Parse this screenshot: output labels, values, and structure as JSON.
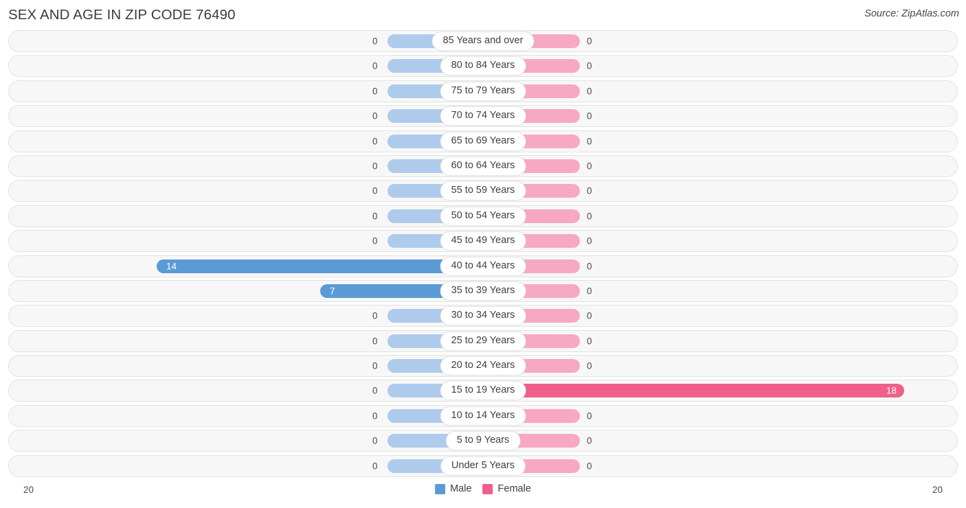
{
  "header": {
    "title": "SEX AND AGE IN ZIP CODE 76490",
    "source": "Source: ZipAtlas.com"
  },
  "legend": {
    "male_label": "Male",
    "female_label": "Female",
    "male_color": "#5b9bd5",
    "female_color": "#ef5f8a",
    "male_zero_color": "#aecbec",
    "female_zero_color": "#f7a8c2"
  },
  "axis": {
    "left_max": "20",
    "right_max": "20"
  },
  "chart_data": {
    "type": "bar",
    "title": "SEX AND AGE IN ZIP CODE 76490",
    "subtitle": "",
    "xlabel": "",
    "ylabel": "",
    "orientation": "horizontal",
    "layout": "population-pyramid",
    "grid": false,
    "legend_position": "bottom-center",
    "xlim": [
      0,
      20
    ],
    "categories": [
      "85 Years and over",
      "80 to 84 Years",
      "75 to 79 Years",
      "70 to 74 Years",
      "65 to 69 Years",
      "60 to 64 Years",
      "55 to 59 Years",
      "50 to 54 Years",
      "45 to 49 Years",
      "40 to 44 Years",
      "35 to 39 Years",
      "30 to 34 Years",
      "25 to 29 Years",
      "20 to 24 Years",
      "15 to 19 Years",
      "10 to 14 Years",
      "5 to 9 Years",
      "Under 5 Years"
    ],
    "series": [
      {
        "name": "Male",
        "color": "#5b9bd5",
        "values": [
          0,
          0,
          0,
          0,
          0,
          0,
          0,
          0,
          0,
          14,
          7,
          0,
          0,
          0,
          0,
          0,
          0,
          0
        ]
      },
      {
        "name": "Female",
        "color": "#ef5f8a",
        "values": [
          0,
          0,
          0,
          0,
          0,
          0,
          0,
          0,
          0,
          0,
          0,
          0,
          0,
          0,
          18,
          0,
          0,
          0
        ]
      }
    ]
  },
  "rows": [
    {
      "label": "85 Years and over",
      "male": "0",
      "female": "0"
    },
    {
      "label": "80 to 84 Years",
      "male": "0",
      "female": "0"
    },
    {
      "label": "75 to 79 Years",
      "male": "0",
      "female": "0"
    },
    {
      "label": "70 to 74 Years",
      "male": "0",
      "female": "0"
    },
    {
      "label": "65 to 69 Years",
      "male": "0",
      "female": "0"
    },
    {
      "label": "60 to 64 Years",
      "male": "0",
      "female": "0"
    },
    {
      "label": "55 to 59 Years",
      "male": "0",
      "female": "0"
    },
    {
      "label": "50 to 54 Years",
      "male": "0",
      "female": "0"
    },
    {
      "label": "45 to 49 Years",
      "male": "0",
      "female": "0"
    },
    {
      "label": "40 to 44 Years",
      "male": "14",
      "female": "0"
    },
    {
      "label": "35 to 39 Years",
      "male": "7",
      "female": "0"
    },
    {
      "label": "30 to 34 Years",
      "male": "0",
      "female": "0"
    },
    {
      "label": "25 to 29 Years",
      "male": "0",
      "female": "0"
    },
    {
      "label": "20 to 24 Years",
      "male": "0",
      "female": "0"
    },
    {
      "label": "15 to 19 Years",
      "male": "0",
      "female": "18"
    },
    {
      "label": "10 to 14 Years",
      "male": "0",
      "female": "0"
    },
    {
      "label": "5 to 9 Years",
      "male": "0",
      "female": "0"
    },
    {
      "label": "Under 5 Years",
      "male": "0",
      "female": "0"
    }
  ]
}
